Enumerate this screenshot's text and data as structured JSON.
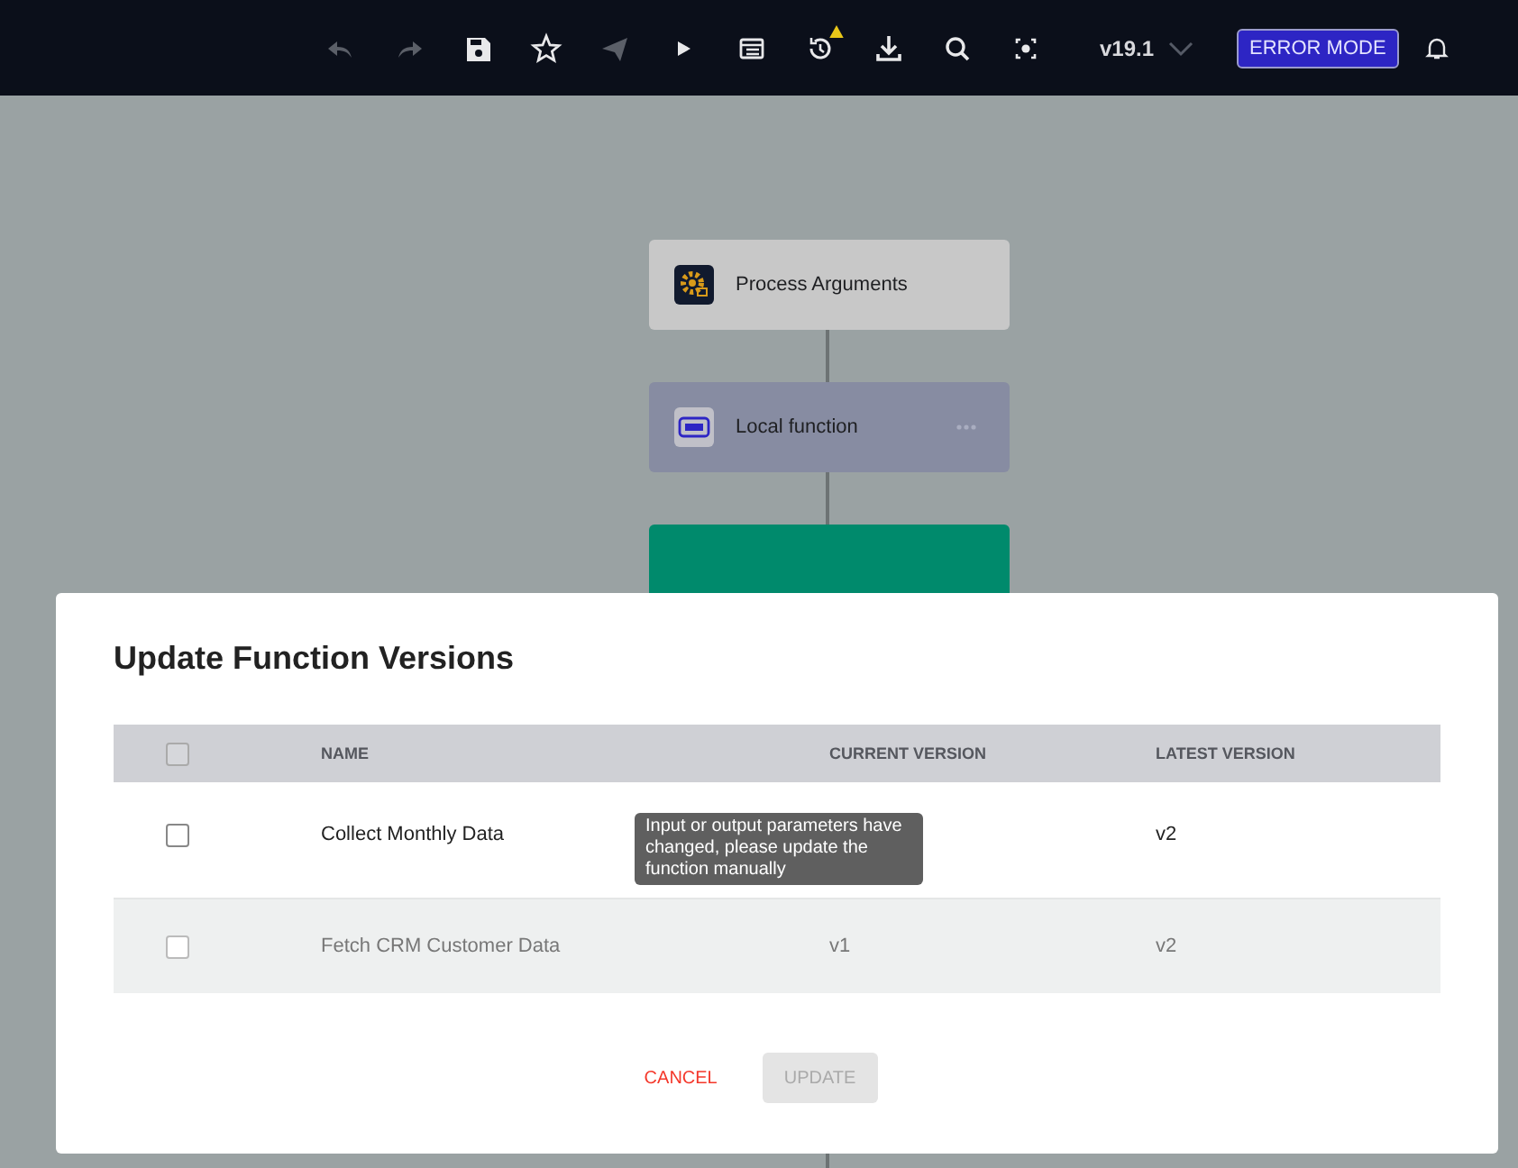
{
  "toolbar": {
    "tools": [
      {
        "kind": "undo",
        "disabled": true
      },
      {
        "kind": "redo",
        "disabled": true
      },
      {
        "kind": "save",
        "disabled": false
      },
      {
        "kind": "star",
        "disabled": false
      },
      {
        "kind": "send",
        "disabled": true
      },
      {
        "kind": "play",
        "disabled": false
      },
      {
        "kind": "table",
        "disabled": false
      },
      {
        "kind": "history",
        "disabled": false,
        "warning": true
      },
      {
        "kind": "download",
        "disabled": false
      },
      {
        "kind": "search",
        "disabled": false
      },
      {
        "kind": "focus",
        "disabled": false
      }
    ],
    "version": "v19.1",
    "mode_button": "ERROR MODE"
  },
  "canvas": {
    "nodes": [
      {
        "kind": "gear",
        "label": "Process Arguments",
        "menu": false
      },
      {
        "kind": "local",
        "label": "Local function",
        "menu": true
      },
      {
        "kind": "step"
      }
    ]
  },
  "dialog": {
    "title": "Update Function Versions",
    "columns": [
      "NAME",
      "CURRENT VERSION",
      "LATEST VERSION"
    ],
    "select_all_checked": false,
    "rows": [
      {
        "name": "Collect Monthly Data",
        "latest_version": "v2",
        "checked": false,
        "disabled": false
      },
      {
        "name": "Fetch CRM Customer Data",
        "current_version": "v1",
        "latest_version": "v2",
        "checked": false,
        "disabled": true
      }
    ],
    "tooltip": "Input or output parameters have changed, please update the function manually",
    "buttons": [
      {
        "label": "CANCEL",
        "kind": "text",
        "disabled": false
      },
      {
        "label": "UPDATE",
        "kind": "filled",
        "disabled": true
      }
    ]
  }
}
